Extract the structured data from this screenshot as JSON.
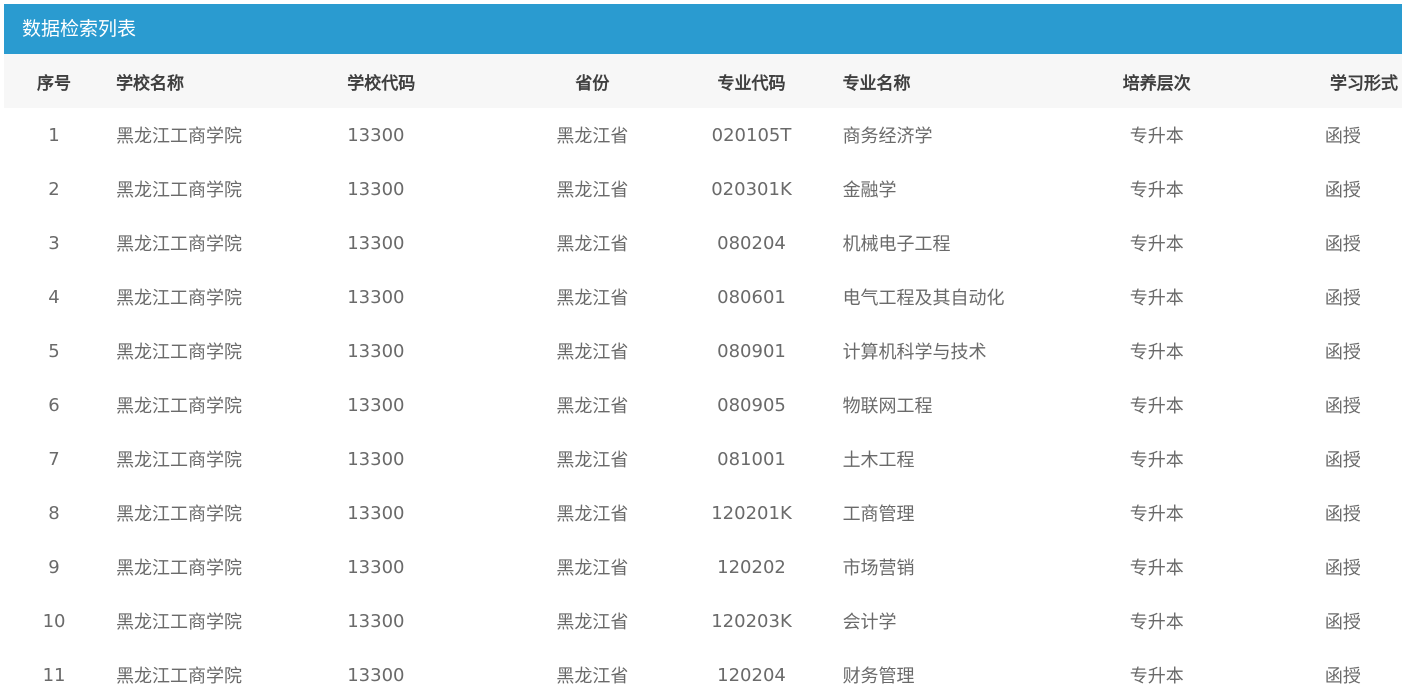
{
  "panel": {
    "title": "数据检索列表"
  },
  "colors": {
    "header_bar": "#2a9bd0",
    "table_head_bg": "#f7f7f7",
    "head_text": "#3f3f3f",
    "cell_text": "#6a6a6a"
  },
  "table": {
    "columns": [
      "序号",
      "学校名称",
      "学校代码",
      "省份",
      "专业代码",
      "专业名称",
      "培养层次",
      "学习形式"
    ],
    "rows": [
      [
        "1",
        "黑龙江工商学院",
        "13300",
        "黑龙江省",
        "020105T",
        "商务经济学",
        "专升本",
        "函授"
      ],
      [
        "2",
        "黑龙江工商学院",
        "13300",
        "黑龙江省",
        "020301K",
        "金融学",
        "专升本",
        "函授"
      ],
      [
        "3",
        "黑龙江工商学院",
        "13300",
        "黑龙江省",
        "080204",
        "机械电子工程",
        "专升本",
        "函授"
      ],
      [
        "4",
        "黑龙江工商学院",
        "13300",
        "黑龙江省",
        "080601",
        "电气工程及其自动化",
        "专升本",
        "函授"
      ],
      [
        "5",
        "黑龙江工商学院",
        "13300",
        "黑龙江省",
        "080901",
        "计算机科学与技术",
        "专升本",
        "函授"
      ],
      [
        "6",
        "黑龙江工商学院",
        "13300",
        "黑龙江省",
        "080905",
        "物联网工程",
        "专升本",
        "函授"
      ],
      [
        "7",
        "黑龙江工商学院",
        "13300",
        "黑龙江省",
        "081001",
        "土木工程",
        "专升本",
        "函授"
      ],
      [
        "8",
        "黑龙江工商学院",
        "13300",
        "黑龙江省",
        "120201K",
        "工商管理",
        "专升本",
        "函授"
      ],
      [
        "9",
        "黑龙江工商学院",
        "13300",
        "黑龙江省",
        "120202",
        "市场营销",
        "专升本",
        "函授"
      ],
      [
        "10",
        "黑龙江工商学院",
        "13300",
        "黑龙江省",
        "120203K",
        "会计学",
        "专升本",
        "函授"
      ],
      [
        "11",
        "黑龙江工商学院",
        "13300",
        "黑龙江省",
        "120204",
        "财务管理",
        "专升本",
        "函授"
      ]
    ]
  }
}
